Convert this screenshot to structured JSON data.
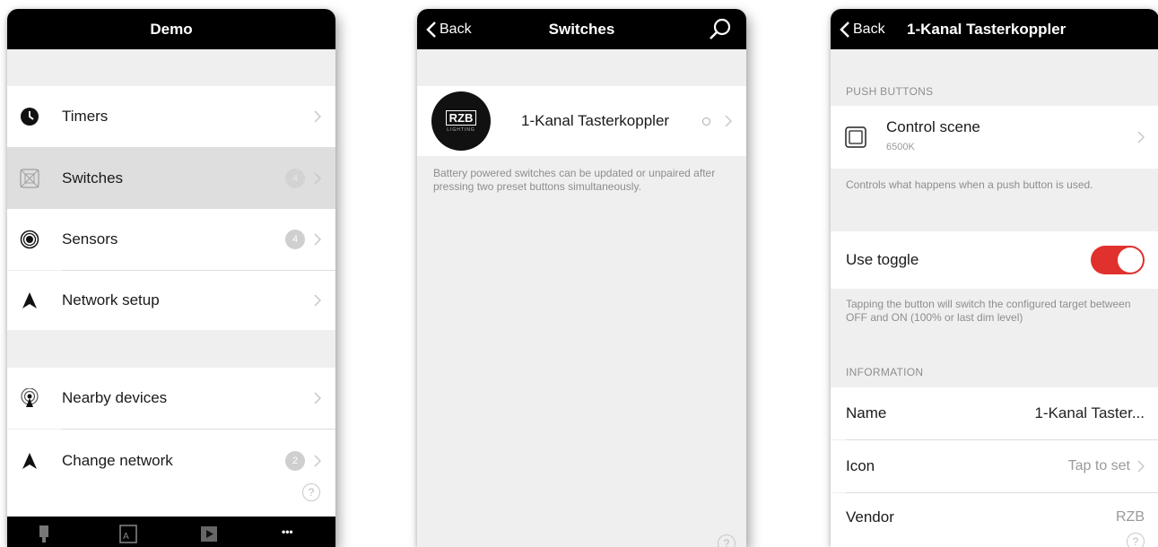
{
  "screen1": {
    "title": "Demo",
    "items": [
      {
        "label": "Timers"
      },
      {
        "label": "Switches",
        "badge": "4"
      },
      {
        "label": "Sensors",
        "badge": "4"
      },
      {
        "label": "Network setup"
      },
      {
        "label": "Nearby devices"
      },
      {
        "label": "Change network",
        "badge": "2"
      }
    ],
    "help": "?",
    "tab_more": "•••"
  },
  "screen2": {
    "back": "Back",
    "title": "Switches",
    "device_logo": "RZB",
    "device_logo_sub": "LIGHTING",
    "device_name": "1-Kanal Tasterkoppler",
    "footnote": "Battery powered switches can be updated or unpaired after pressing two preset buttons simultaneously.",
    "help": "?"
  },
  "screen3": {
    "back": "Back",
    "title": "1-Kanal Tasterkoppler",
    "push_header": "PUSH BUTTONS",
    "control_title": "Control scene",
    "control_sub": "6500K",
    "control_note": "Controls what happens when a push button is used.",
    "toggle_label": "Use toggle",
    "toggle_on": true,
    "toggle_note": "Tapping the button will switch the configured target between OFF and ON (100% or last dim level)",
    "info_header": "INFORMATION",
    "name_label": "Name",
    "name_value": "1-Kanal Taster...",
    "icon_label": "Icon",
    "icon_value": "Tap to set",
    "vendor_label": "Vendor",
    "vendor_value": "RZB",
    "help": "?"
  },
  "colors": {
    "accent_toggle": "#e0312d",
    "navbar": "#000000",
    "background": "#efefef"
  }
}
